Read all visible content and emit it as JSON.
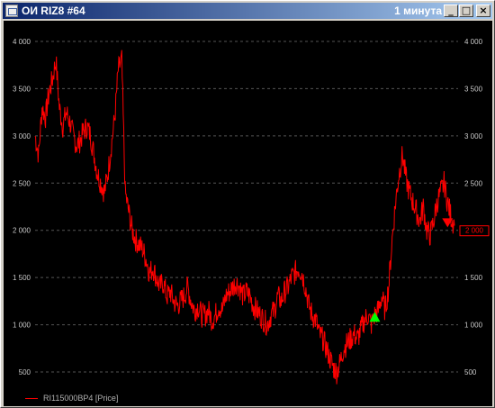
{
  "window": {
    "title": "ОИ RIZ8 #64",
    "timeframe": "1 минута",
    "minimize_glyph": "_",
    "maximize_glyph": "□",
    "close_glyph": "×",
    "icon": "chart-window-icon"
  },
  "colors": {
    "background": "#000000",
    "price": "#ff0000",
    "grid": "#555555",
    "axis_text": "#c8c8c8",
    "buy_marker": "#00ff00",
    "sell_marker": "#ff0000",
    "titlebar_start": "#0a246a",
    "titlebar_end": "#a6caf0"
  },
  "chart_data": {
    "type": "line",
    "title": "",
    "xlabel": "",
    "ylabel": "",
    "ylim": [
      300,
      4200
    ],
    "yticks": [
      500,
      1000,
      1500,
      2000,
      2500,
      3000,
      3500,
      4000
    ],
    "ytick_labels": [
      "500",
      "1 000",
      "1 500",
      "2 000",
      "2 500",
      "3 000",
      "3 500",
      "4 000"
    ],
    "grid": true,
    "legend_position": "bottom-left",
    "series": [
      {
        "name": "RI115000BP4 [Price]",
        "values": [
          3000,
          2800,
          3300,
          3200,
          3450,
          3600,
          3800,
          3300,
          3100,
          3250,
          3150,
          3000,
          2900,
          2950,
          3050,
          3100,
          3000,
          2800,
          2600,
          2500,
          2400,
          2600,
          2900,
          3200,
          3700,
          3800,
          2400,
          2200,
          2000,
          1900,
          1850,
          1800,
          1700,
          1550,
          1600,
          1500,
          1400,
          1450,
          1300,
          1350,
          1250,
          1200,
          1250,
          1300,
          1400,
          1250,
          1150,
          1200,
          1100,
          1100,
          1150,
          1050,
          1100,
          1200,
          1150,
          1300,
          1350,
          1400,
          1450,
          1400,
          1300,
          1350,
          1300,
          1200,
          1150,
          1100,
          1050,
          1000,
          1100,
          1150,
          1300,
          1250,
          1350,
          1400,
          1500,
          1550,
          1600,
          1550,
          1400,
          1200,
          1100,
          1050,
          900,
          850,
          750,
          650,
          550,
          500,
          600,
          750,
          800,
          850,
          900,
          850,
          950,
          1050,
          1100,
          1000,
          1100,
          1150,
          1300,
          1150,
          1400,
          1900,
          2300,
          2600,
          2800,
          2550,
          2400,
          2300,
          2200,
          2100,
          2250,
          2000,
          1950,
          2100,
          2300,
          2400,
          2500,
          2300,
          2150,
          2050
        ],
        "last_value_label": "2 000",
        "last_value": 2000
      }
    ],
    "markers": [
      {
        "type": "buy",
        "index": 98,
        "value": 1080
      },
      {
        "type": "sell",
        "index": 119,
        "value": 2080
      }
    ]
  }
}
